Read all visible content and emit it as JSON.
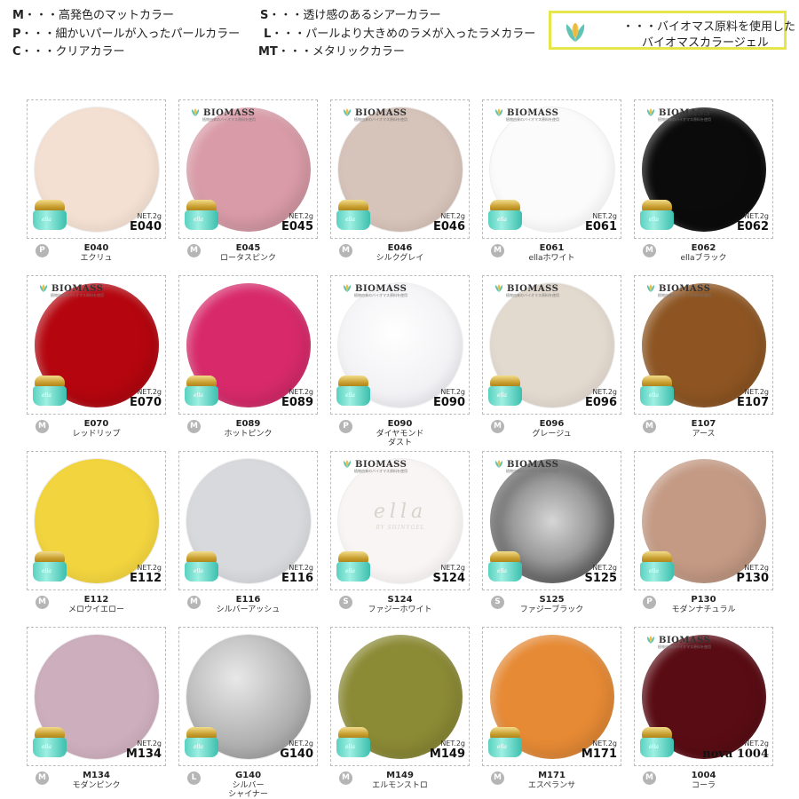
{
  "legend": {
    "lines": [
      {
        "key": "M",
        "text": "・・・高発色のマットカラー"
      },
      {
        "key": "P",
        "text": "・・・細かいパールが入ったパールカラー"
      },
      {
        "key": "C",
        "text": "・・・クリアカラー"
      },
      {
        "key": "S",
        "text": "・・・透け感のあるシアーカラー"
      },
      {
        "key": "L",
        "text": "・・・パールより大きめのラメが入ったラメカラー"
      },
      {
        "key": "MT",
        "text": "・・・メタリックカラー"
      }
    ],
    "biomass_note": {
      "line1": "・・・バイオマス原料を使用した",
      "line2": "バイオマスカラージェル",
      "border_color": "#e6e64a"
    }
  },
  "biomass_label": "BIOMASS",
  "biomass_sub": "植物由来のバイオマス原料を使用",
  "net_label": "NET.2g",
  "ella_logo": {
    "main": "ella",
    "sub": "BY SHINYGEL"
  },
  "products": [
    {
      "code": "E040",
      "badge_code": "E040",
      "name": [
        "エクリュ"
      ],
      "type": "P",
      "color": "#f3e0d3",
      "biomass": false,
      "light": true
    },
    {
      "code": "E045",
      "badge_code": "E045",
      "name": [
        "ロータスピンク"
      ],
      "type": "M",
      "color": "#d99ba7",
      "biomass": true,
      "light": false
    },
    {
      "code": "E046",
      "badge_code": "E046",
      "name": [
        "シルクグレイ"
      ],
      "type": "M",
      "color": "#d6c3b9",
      "biomass": true,
      "light": true
    },
    {
      "code": "E061",
      "badge_code": "E061",
      "name": [
        "ellaホワイト"
      ],
      "type": "M",
      "color": "#fbfbfb",
      "biomass": true,
      "light": true
    },
    {
      "code": "E062",
      "badge_code": "E062",
      "name": [
        "ellaブラック"
      ],
      "type": "M",
      "color": "#0b0b0b",
      "biomass": true,
      "light": false
    },
    {
      "code": "E070",
      "badge_code": "E070",
      "name": [
        "レッドリップ"
      ],
      "type": "M",
      "color": "#b5060f",
      "biomass": true,
      "light": false
    },
    {
      "code": "E089",
      "badge_code": "E089",
      "name": [
        "ホットピンク"
      ],
      "type": "M",
      "color": "#d82a6b",
      "biomass": false,
      "light": false
    },
    {
      "code": "E090",
      "badge_code": "E090",
      "name": [
        "ダイヤモンド",
        "ダスト"
      ],
      "type": "P",
      "color": "#f5f4f7",
      "biomass": true,
      "light": true
    },
    {
      "code": "E096",
      "badge_code": "E096",
      "name": [
        "グレージュ"
      ],
      "type": "M",
      "color": "#e2d9cf",
      "biomass": true,
      "light": true
    },
    {
      "code": "E107",
      "badge_code": "E107",
      "name": [
        "アース"
      ],
      "type": "M",
      "color": "#8e5522",
      "biomass": true,
      "light": false
    },
    {
      "code": "E112",
      "badge_code": "E112",
      "name": [
        "メロウイエロー"
      ],
      "type": "M",
      "color": "#f2d43f",
      "biomass": false,
      "light": true
    },
    {
      "code": "E116",
      "badge_code": "E116",
      "name": [
        "シルバーアッシュ"
      ],
      "type": "M",
      "color": "#d8d9dc",
      "biomass": false,
      "light": true
    },
    {
      "code": "S124",
      "badge_code": "S124",
      "name": [
        "ファジーホワイト"
      ],
      "type": "S",
      "color": "#f8f5f4",
      "biomass": true,
      "light": true,
      "ella": true
    },
    {
      "code": "S125",
      "badge_code": "S125",
      "name": [
        "ファジーブラック"
      ],
      "type": "S",
      "color": "#8a8a8a",
      "biomass": true,
      "light": false
    },
    {
      "code": "P130",
      "badge_code": "P130",
      "name": [
        "モダンナチュラル"
      ],
      "type": "P",
      "color": "#c49a84",
      "biomass": false,
      "light": false
    },
    {
      "code": "M134",
      "badge_code": "M134",
      "name": [
        "モダンピンク"
      ],
      "type": "M",
      "color": "#cdaebd",
      "biomass": false,
      "light": true
    },
    {
      "code": "G140",
      "badge_code": "G140",
      "name": [
        "シルバー",
        "シャイナー"
      ],
      "type": "L",
      "color": "#b9b9b9",
      "biomass": false,
      "light": true
    },
    {
      "code": "M149",
      "badge_code": "M149",
      "name": [
        "エルモンストロ"
      ],
      "type": "M",
      "color": "#8b8a35",
      "biomass": false,
      "light": false
    },
    {
      "code": "M171",
      "badge_code": "M171",
      "name": [
        "エスペランサ"
      ],
      "type": "M",
      "color": "#e68a35",
      "biomass": false,
      "light": false
    },
    {
      "code": "1004",
      "badge_code": "nova 1004",
      "name": [
        "コーラ"
      ],
      "type": "M",
      "color": "#5a0c14",
      "biomass": true,
      "light": false
    }
  ]
}
